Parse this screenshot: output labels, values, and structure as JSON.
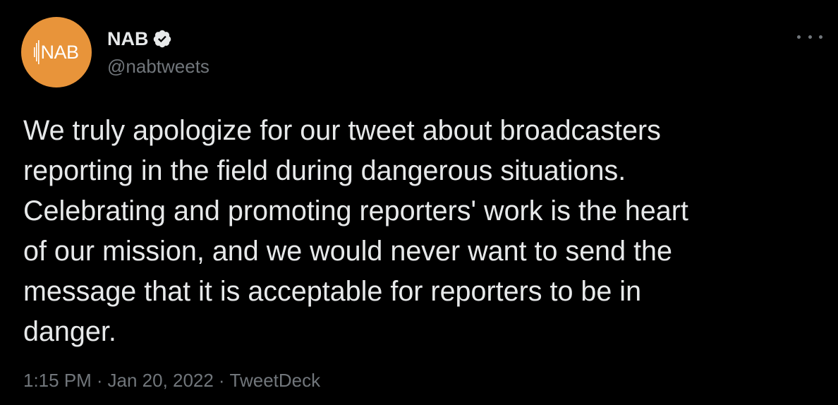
{
  "tweet": {
    "author": {
      "display_name": "NAB",
      "handle": "@nabtweets",
      "avatar_text": "NAB",
      "verified": true
    },
    "text": "We truly apologize for our tweet about broadcasters\nreporting in the field during dangerous situations.\nCelebrating and promoting reporters' work is the heart\nof our mission, and we would never want to send the\nmessage that it is acceptable for reporters to be in\ndanger.",
    "time": "1:15 PM",
    "date": "Jan 20, 2022",
    "source": "TweetDeck",
    "separator": "·"
  },
  "colors": {
    "background": "#000000",
    "text_primary": "#e7e9ea",
    "text_secondary": "#71767b",
    "avatar_bg": "#e8943a"
  },
  "icons": {
    "verified": "verified-badge-icon",
    "more": "more-options-icon"
  }
}
